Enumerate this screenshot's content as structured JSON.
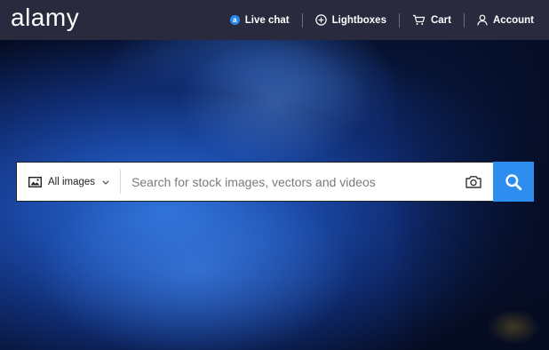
{
  "header": {
    "logo": "alamy",
    "nav": [
      {
        "label": "Live chat",
        "icon": "chat-icon"
      },
      {
        "label": "Lightboxes",
        "icon": "plus-circle-icon"
      },
      {
        "label": "Cart",
        "icon": "cart-icon"
      },
      {
        "label": "Account",
        "icon": "user-icon"
      }
    ],
    "chat_badge": "a"
  },
  "search": {
    "scope_label": "All images",
    "placeholder": "Search for stock images, vectors and videos",
    "value": ""
  },
  "colors": {
    "header_bg": "#2a2a3e",
    "accent": "#2e8ef0",
    "hero": "#1b4aa8"
  }
}
